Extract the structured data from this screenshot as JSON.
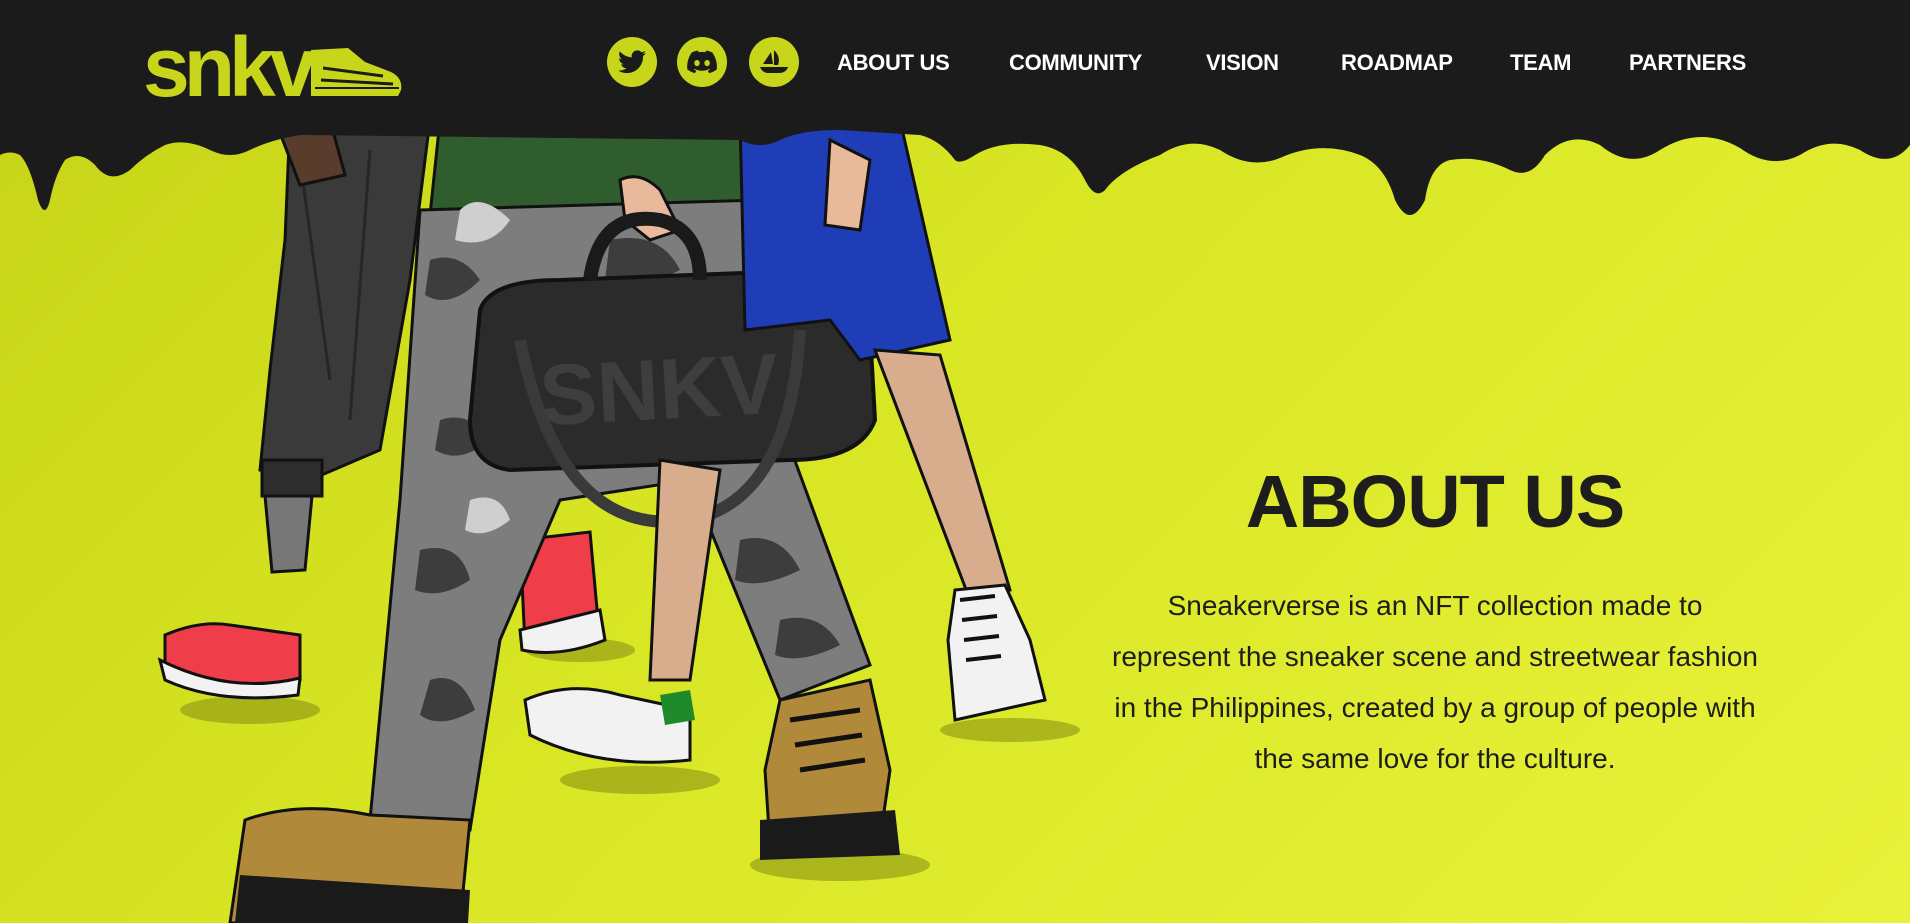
{
  "brand": {
    "logo_text": "snkv",
    "accent_color": "#c8d61b",
    "header_bg": "#1b1b1b"
  },
  "header": {
    "social": [
      {
        "name": "twitter-icon"
      },
      {
        "name": "discord-icon"
      },
      {
        "name": "opensea-icon"
      }
    ],
    "nav": [
      {
        "label": "ABOUT US"
      },
      {
        "label": "COMMUNITY"
      },
      {
        "label": "VISION"
      },
      {
        "label": "ROADMAP"
      },
      {
        "label": "TEAM"
      },
      {
        "label": "PARTNERS"
      }
    ]
  },
  "hero": {
    "bag_text": "SNKV",
    "about_title": "ABOUT US",
    "about_text": "Sneakerverse is an NFT collection made to represent the sneaker scene and streetwear fashion in the Philippines, created by a group of people with the same love for the culture."
  }
}
